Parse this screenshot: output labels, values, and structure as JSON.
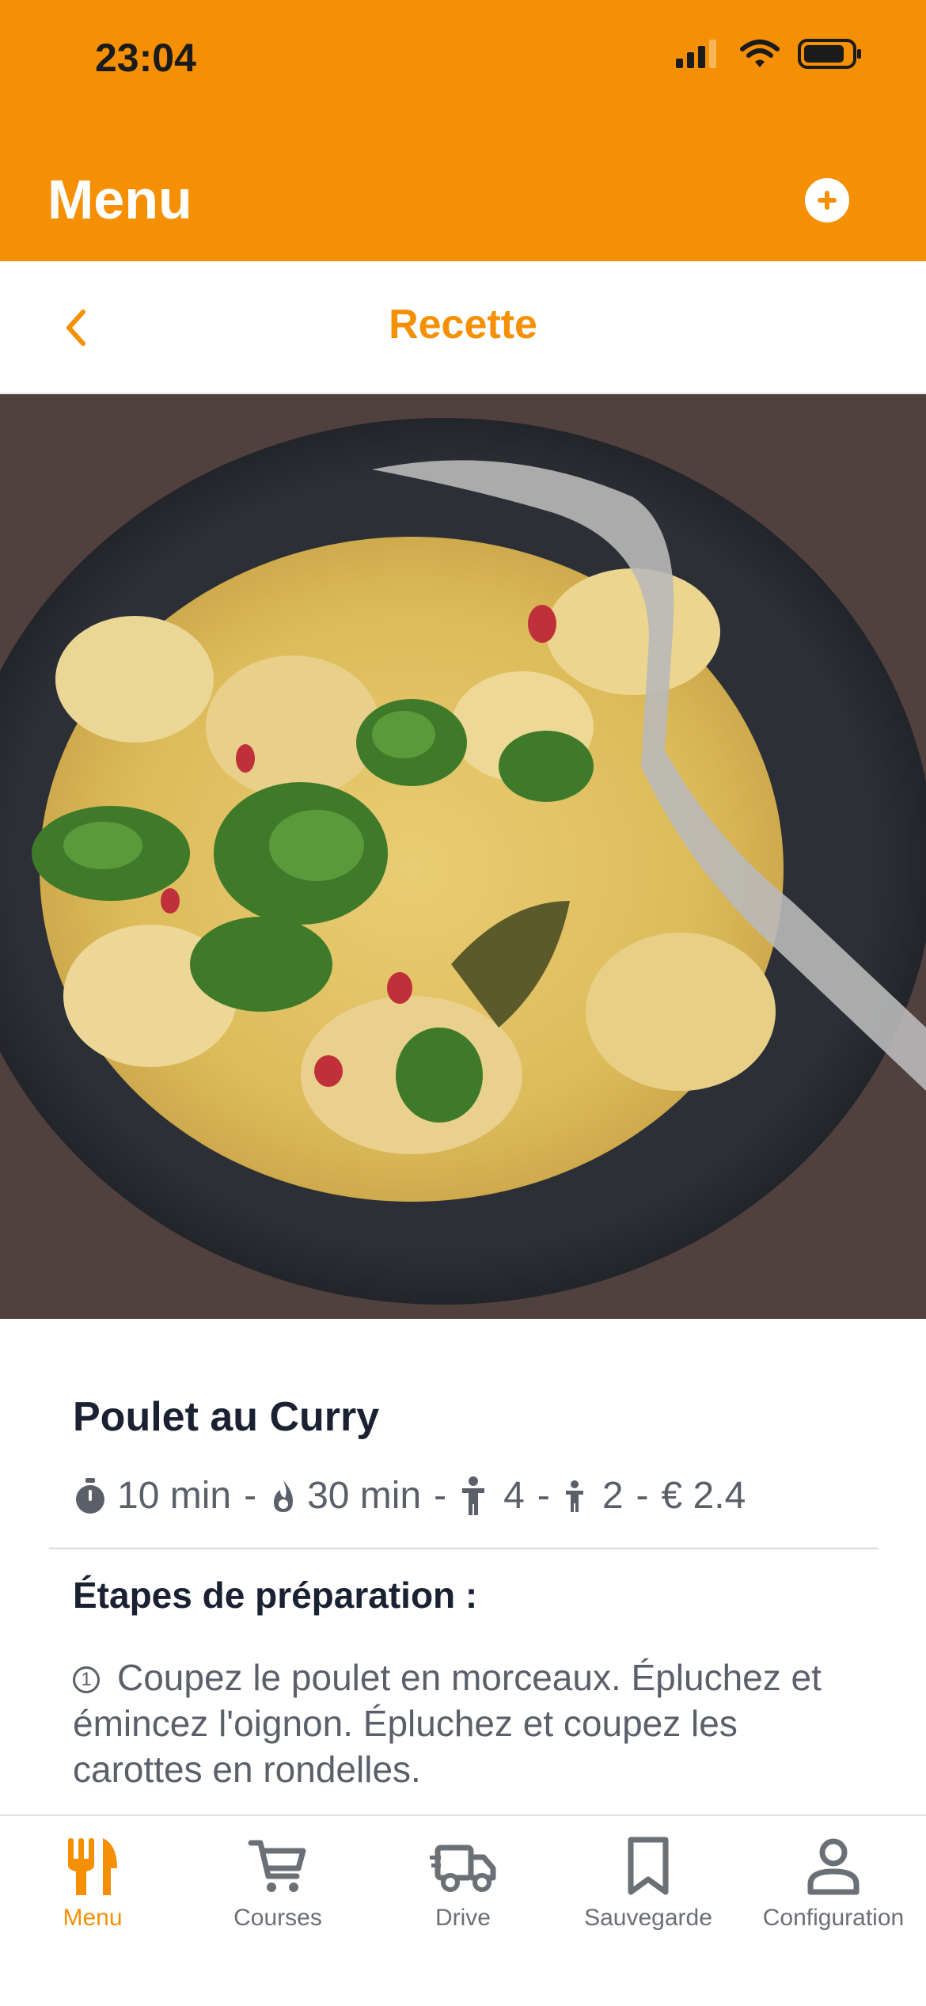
{
  "status_bar": {
    "time": "23:04"
  },
  "header": {
    "title": "Menu"
  },
  "subheader": {
    "title": "Recette"
  },
  "recipe": {
    "name": "Poulet au Curry",
    "prep_time": "10 min",
    "cook_time": "30 min",
    "adults": "4",
    "children": "2",
    "price": "€ 2.4",
    "separator": "-"
  },
  "steps": {
    "title": "Étapes de préparation :",
    "items": [
      {
        "number": "1",
        "text": "Coupez le poulet en morceaux. Épluchez et émincez l'oignon. Épluchez et coupez les carottes en rondelles."
      }
    ]
  },
  "tabs": [
    {
      "label": "Menu",
      "icon": "fork-knife-icon",
      "active": true
    },
    {
      "label": "Courses",
      "icon": "cart-icon",
      "active": false
    },
    {
      "label": "Drive",
      "icon": "truck-icon",
      "active": false
    },
    {
      "label": "Sauvegarde",
      "icon": "bookmark-icon",
      "active": false
    },
    {
      "label": "Configuration",
      "icon": "person-icon",
      "active": false
    }
  ],
  "colors": {
    "accent": "#F59005",
    "text_dark": "#1a2133",
    "text_muted": "#5b5f6a",
    "tab_inactive": "#6b6f76"
  }
}
